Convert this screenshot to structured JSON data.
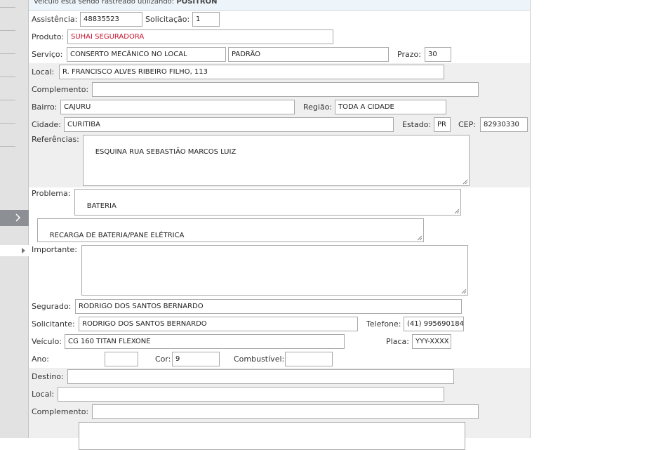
{
  "tracking": {
    "text": "Veículo está sendo rastreado utilizando:",
    "system": "POSITRON"
  },
  "fields": {
    "assistencia": {
      "label": "Assistência:",
      "value": "48835523"
    },
    "solicitacao": {
      "label": "Solicitação:",
      "value": "1"
    },
    "produto": {
      "label": "Produto:",
      "value": "SUHAI SEGURADORA"
    },
    "servico": {
      "label": "Serviço:",
      "value": "CONSERTO MECÂNICO NO LOCAL",
      "tipo": "PADRÃO"
    },
    "prazo": {
      "label": "Prazo:",
      "value": "30"
    },
    "local": {
      "label": "Local:",
      "value": "R. FRANCISCO ALVES RIBEIRO FILHO, 113"
    },
    "complemento": {
      "label": "Complemento:",
      "value": ""
    },
    "bairro": {
      "label": "Bairro:",
      "value": "CAJURU"
    },
    "regiao": {
      "label": "Região:",
      "value": "TODA A CIDADE"
    },
    "cidade": {
      "label": "Cidade:",
      "value": "CURITIBA"
    },
    "estado": {
      "label": "Estado:",
      "value": "PR"
    },
    "cep": {
      "label": "CEP:",
      "value": "82930330"
    },
    "referencias": {
      "label": "Referências:",
      "value": "ESQUINA RUA SEBASTIÃO MARCOS LUIZ"
    },
    "problema": {
      "label": "Problema:",
      "value": "BATERIA",
      "detalhe": "RECARGA DE BATERIA/PANE ELÉTRICA"
    },
    "importante": {
      "label": "Importante:",
      "value": ""
    },
    "segurado": {
      "label": "Segurado:",
      "value": "RODRIGO DOS SANTOS BERNARDO"
    },
    "solicitante": {
      "label": "Solicitante:",
      "value": "RODRIGO DOS SANTOS BERNARDO"
    },
    "telefone": {
      "label": "Telefone:",
      "value": "(41) 995690184"
    },
    "veiculo": {
      "label": "Veículo:",
      "value": "CG 160 TITAN FLEXONE"
    },
    "placa": {
      "label": "Placa:",
      "value": "YYY-XXXX"
    },
    "ano": {
      "label": "Ano:",
      "value": ""
    },
    "cor": {
      "label": "Cor:",
      "value": "9"
    },
    "combustivel": {
      "label": "Combustível:",
      "value": ""
    },
    "destino": {
      "label": "Destino:",
      "value": ""
    },
    "destino_local": {
      "label": "Local:",
      "value": ""
    },
    "destino_complemento": {
      "label": "Complemento:",
      "value": ""
    }
  },
  "colors": {
    "produto_text": "#c8102e",
    "sidebar_bg": "#e2e2e2",
    "band_bg": "#efefef"
  }
}
